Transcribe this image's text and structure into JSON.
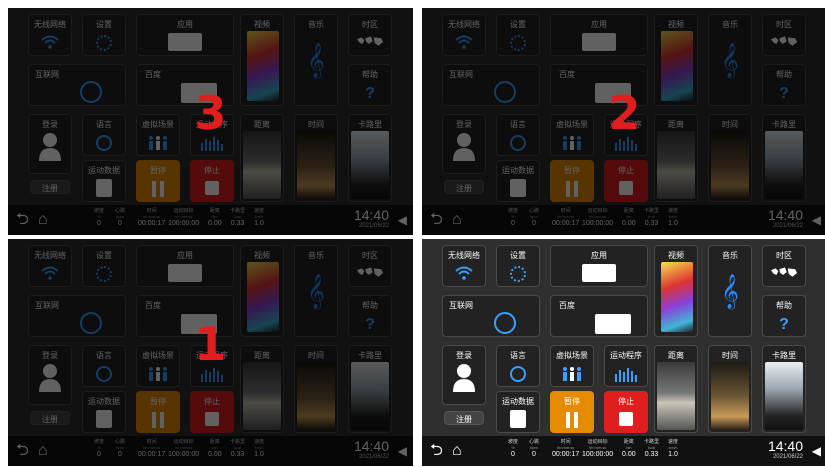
{
  "countdown": [
    "3",
    "2",
    "1"
  ],
  "tiles": {
    "wifi": "无线网络",
    "settings": "设置",
    "apps": "应用",
    "video": "视频",
    "music": "音乐",
    "timezone": "时区",
    "internet": "互联网",
    "baidu": "百度",
    "help": "帮助",
    "login": "登录",
    "register": "注册",
    "language": "语言",
    "virtual_scene": "虚拟场景",
    "program": "运动程序",
    "distance": "距离",
    "time": "时间",
    "calories": "卡路里",
    "sport_data": "运动数据",
    "pause": "暂停",
    "stop": "停止"
  },
  "stats": [
    {
      "label": "坡度",
      "unit": "%",
      "value": "0"
    },
    {
      "label": "心跳",
      "unit": "bpm",
      "value": "0"
    },
    {
      "label": "时间",
      "unit": "hh:mm:ss",
      "value": "00:00:17"
    },
    {
      "label": "运动目标",
      "unit": "hh:mm:ss",
      "value": "100:00:00"
    },
    {
      "label": "距离",
      "unit": "km",
      "value": "0.00"
    },
    {
      "label": "卡路里",
      "unit": "kcal",
      "value": "0.33"
    },
    {
      "label": "速度",
      "unit": "km/h",
      "value": "1.0"
    }
  ],
  "clock": {
    "time": "14:40",
    "date": "2021/06/22"
  },
  "colors": {
    "pause": "#e68a00",
    "stop": "#e01e1e",
    "accent": "#3aa0ff",
    "countdown": "#e01e1e"
  }
}
